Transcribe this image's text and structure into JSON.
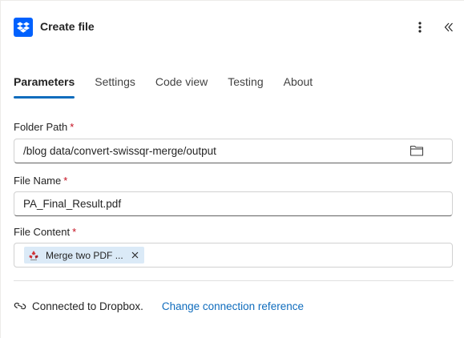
{
  "header": {
    "title": "Create file",
    "icon": "dropbox-icon",
    "brand_color": "#0061fe"
  },
  "tabs": [
    {
      "label": "Parameters",
      "active": true
    },
    {
      "label": "Settings",
      "active": false
    },
    {
      "label": "Code view",
      "active": false
    },
    {
      "label": "Testing",
      "active": false
    },
    {
      "label": "About",
      "active": false
    }
  ],
  "fields": {
    "folder_path": {
      "label": "Folder Path",
      "required": "*",
      "value": "/blog data/convert-swissqr-merge/output"
    },
    "file_name": {
      "label": "File Name",
      "required": "*",
      "value": "PA_Final_Result.pdf"
    },
    "file_content": {
      "label": "File Content",
      "required": "*",
      "token_label": "Merge two PDF ..."
    }
  },
  "footer": {
    "connection_text": "Connected to Dropbox.",
    "change_link": "Change connection reference"
  },
  "colors": {
    "accent": "#0f6cbd",
    "required": "#c50f1f",
    "token_bg": "#dbeaf7"
  }
}
